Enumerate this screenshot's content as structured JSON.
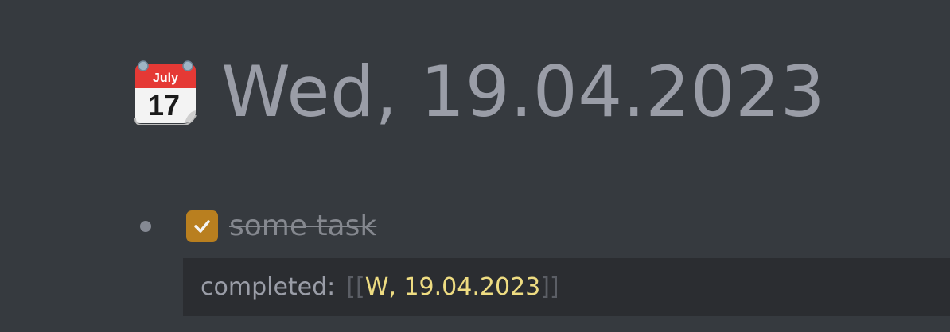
{
  "page": {
    "icon": "calendar-icon",
    "icon_month": "July",
    "icon_day": "17",
    "title": "Wed, 19.04.2023"
  },
  "task": {
    "checked": true,
    "text": "some task",
    "checkbox_icon": "checkmark-icon"
  },
  "properties": {
    "key": "completed:",
    "open_bracket": "[[",
    "link_text": "W, 19.04.2023",
    "close_bracket": "]]"
  },
  "colors": {
    "background": "#363a3f",
    "title": "#9a9da7",
    "checkbox_checked": "#b97f1f",
    "properties_background": "#2b2d31",
    "link": "#eedc82"
  }
}
